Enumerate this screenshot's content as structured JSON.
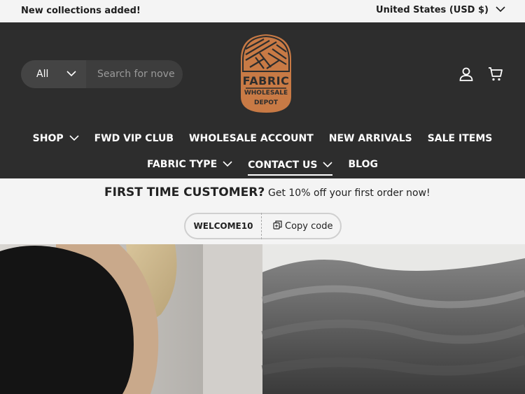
{
  "announcement": {
    "message": "New collections added!",
    "country": "United States (USD $)"
  },
  "search": {
    "category": "All",
    "placeholder": "Search for nove"
  },
  "logo": {
    "line1": "FABRIC",
    "line2": "WHOLESALE",
    "line3": "DEPOT"
  },
  "header_icons": [
    "account-icon",
    "cart-icon"
  ],
  "nav": {
    "row1": [
      {
        "label": "SHOP",
        "dropdown": true
      },
      {
        "label": "FWD VIP CLUB",
        "dropdown": false
      },
      {
        "label": "WHOLESALE ACCOUNT",
        "dropdown": false
      },
      {
        "label": "NEW ARRIVALS",
        "dropdown": false
      },
      {
        "label": "SALE ITEMS",
        "dropdown": false
      }
    ],
    "row2": [
      {
        "label": "FABRIC TYPE",
        "dropdown": true
      },
      {
        "label": "CONTACT US",
        "dropdown": true,
        "active": true
      },
      {
        "label": "BLOG",
        "dropdown": false
      }
    ]
  },
  "promo": {
    "title": "FIRST TIME CUSTOMER?",
    "subtitle": "Get 10% off your first order now!",
    "code": "WELCOME10",
    "copy_label": "Copy code"
  },
  "colors": {
    "header_bg": "#2d2d2d",
    "logo_orange": "#c87a45",
    "page_bg": "#f4f4f4"
  }
}
